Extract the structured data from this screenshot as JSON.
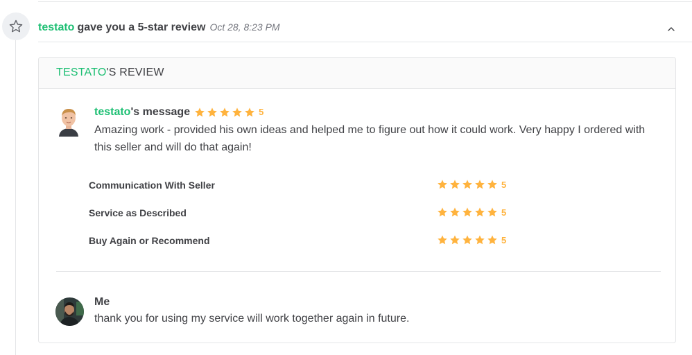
{
  "event": {
    "username": "testato",
    "action": "gave you a 5-star review",
    "date": "Oct 28, 8:23 PM"
  },
  "card": {
    "title_user": "TESTATO",
    "title_suffix": "'S REVIEW"
  },
  "buyer_message": {
    "username": "testato",
    "label_suffix": "'s message",
    "rating": 5,
    "rating_text": "5",
    "text": "Amazing work - provided his own ideas and helped me to figure out how it could work. Very happy I ordered with this seller and will do that again!"
  },
  "ratings": [
    {
      "label": "Communication With Seller",
      "value": 5,
      "value_text": "5"
    },
    {
      "label": "Service as Described",
      "value": 5,
      "value_text": "5"
    },
    {
      "label": "Buy Again or Recommend",
      "value": 5,
      "value_text": "5"
    }
  ],
  "reply": {
    "name": "Me",
    "text": "thank you for using my service will work together again in future."
  },
  "colors": {
    "accent_green": "#1dbf73",
    "star_orange": "#ffb33e",
    "text_dark": "#404145",
    "text_muted": "#74767e"
  },
  "icons": {
    "event_icon": "star-outline-icon",
    "collapse_icon": "chevron-up-icon",
    "rating_icon": "star-icon"
  }
}
